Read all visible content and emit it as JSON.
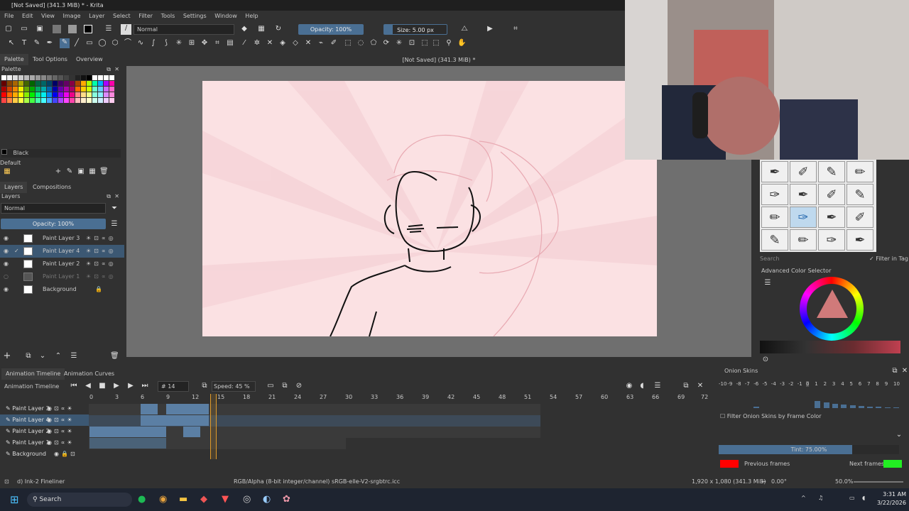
{
  "window": {
    "title": "[Not Saved]  (341.3 MiB) * - Krita"
  },
  "menu": [
    "File",
    "Edit",
    "View",
    "Image",
    "Layer",
    "Select",
    "Filter",
    "Tools",
    "Settings",
    "Window",
    "Help"
  ],
  "toolbar": {
    "blend_mode": "Normal",
    "opacity": "Opacity: 100%",
    "size": "Size: 5.00 px"
  },
  "left_tabs": [
    "Palette",
    "Tool Options",
    "Overview"
  ],
  "palette": {
    "title": "Palette",
    "current_color": "Black",
    "palette_name": "Default"
  },
  "layers_tabs": [
    "Layers",
    "Compositions"
  ],
  "layers_panel": {
    "title": "Layers",
    "blend_mode": "Normal",
    "opacity": "Opacity:  100%",
    "layers": [
      {
        "name": "Paint Layer 3",
        "selected": false
      },
      {
        "name": "Paint Layer 4",
        "selected": true
      },
      {
        "name": "Paint Layer 2",
        "selected": false
      },
      {
        "name": "Paint Layer 1",
        "selected": false
      },
      {
        "name": "Background",
        "selected": false
      }
    ]
  },
  "canvas": {
    "subtitle": "[Not Saved]  (341.3 MiB) *",
    "background_color": "#fbe1e3"
  },
  "brushes": {
    "search_placeholder": "Search",
    "filter_label": "Filter in Tag"
  },
  "color_selector": {
    "title": "Advanced Color Selector"
  },
  "timeline": {
    "tabs": [
      "Animation Timeline",
      "Animation Curves"
    ],
    "title": "Animation Timeline",
    "frame": "14",
    "speed": "Speed: 45 %",
    "ticks": [
      "0",
      "3",
      "6",
      "9",
      "12",
      "15",
      "18",
      "21",
      "24",
      "27",
      "30",
      "33",
      "36",
      "39",
      "42",
      "45",
      "48",
      "51",
      "54",
      "57",
      "60",
      "63",
      "66",
      "69",
      "72"
    ],
    "rows": [
      "Paint Layer 3",
      "Paint Layer 4",
      "Paint Layer 2",
      "Paint Layer 1",
      "Background"
    ]
  },
  "onion": {
    "title": "Onion Skins",
    "scale": [
      "-10",
      "-9",
      "-8",
      "-7",
      "-6",
      "-5",
      "-4",
      "-3",
      "-2",
      "-1",
      "0",
      "1",
      "2",
      "3",
      "4",
      "5",
      "6",
      "7",
      "8",
      "9",
      "10"
    ],
    "filter_label": "Filter Onion Skins by Frame Color",
    "tint": "Tint: 75.00%",
    "previous_label": "Previous frames",
    "next_label": "Next frames",
    "previous_color": "#ff0000",
    "next_color": "#22ee22"
  },
  "status": {
    "brush": "d) Ink-2 Fineliner",
    "color_profile": "RGB/Alpha (8-bit integer/channel)  sRGB-elle-V2-srgbtrc.icc",
    "image_size": "1,920 x 1,080 (341.3 MiB)",
    "rotation": "0.00°",
    "zoom": "50.0%"
  },
  "taskbar": {
    "search": "Search",
    "time": "3:31 AM",
    "date": "3/22/2026"
  }
}
